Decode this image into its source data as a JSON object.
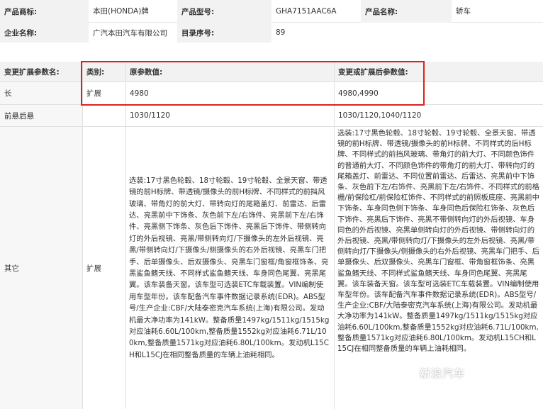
{
  "info": {
    "brand_label": "产品商标:",
    "brand_value": "本田(HONDA)牌",
    "model_label": "产品型号:",
    "model_value": "GHA7151AAC6A",
    "name_label": "产品名称:",
    "name_value": "轿车",
    "company_label": "企业名称:",
    "company_value": "广汽本田汽车有限公司",
    "catalog_label": "目录序号:",
    "catalog_value": "89"
  },
  "changes": {
    "headers": {
      "param": "变更扩展参数名:",
      "type": "类别:",
      "original": "原参数值:",
      "new": "变更或扩展后参数值:"
    },
    "rows": [
      {
        "param": "长",
        "type": "扩展",
        "original": "4980",
        "new": "4980,4990"
      },
      {
        "param": "前悬后悬",
        "type": "",
        "original": "1030/1120",
        "new": "1030/1120,1040/1120"
      },
      {
        "param": "其它",
        "type": "扩展",
        "original": "选装:17寸黑色轮毂、18寸轮毂、19寸轮毂、全景天窗、带透镜的前H标牌、带透镜/摄像头的前H标牌、不同样式的前挡风玻璃、带角灯的前大灯、带转向灯的尾箱盖灯、前雷达、后雷达、亮黑前中下饰条、灰色前下左/右饰件、亮黑前下左/右饰件、亮黑侧下饰条、灰色后下饰件、亮黑后下饰件、带侧转向灯的外后视镜、亮黑/带侧转向灯/下摄像头的左外后视镜、亮黑/带侧转向灯/下摄像头/侧摄像头的右外后视镜、亮黑车门把手、后单摄像头、后双摄像头、亮黑车门窗框/角窗框饰条、亮黑鲨鱼鳍天线、不同样式鲨鱼鳍天线、车身同色尾翼、亮黑尾翼。该车装备天窗。该车型可选装ETC车载装置。VIN编制使用车型年份。该车配备汽车事件数据记录系统(EDR)。ABS型号/生产企业:CBF/大陆泰密克汽车系统(上海)有限公司。发动机最大净功率为141kW。整备质量1497kg/1511kg/1515kg对应油耗6.60L/100km,整备质量1552kg对应油耗6.71L/100km,整备质量1571kg对应油耗6.80L/100km。发动机L15CH和L15CJ在相同整备质量的车辆上油耗相同。",
        "new": "选装:17寸黑色轮毂、18寸轮毂、19寸轮毂、全景天窗、带透镜的前H标牌、带透镜/摄像头的前H标牌、不同样式的后H标牌、不同样式的前挡风玻璃、带角灯的前大灯、不同颜色饰件的普通前大灯、不同颜色饰件的带角灯的前大灯、带转向灯的尾箱盖灯、前雷达、不同位置前雷达、后雷达、亮黑前中下饰条、灰色前下左/右饰件、亮黑前下左/右饰件、不同样式的前格栅/前保险杠/前保险杠饰件、不同样式的前照板底座、亮黑前中下饰条、车身同色侧下饰条、车身同色后保险杠饰条、灰色后下饰件、亮黑后下饰件、亮黑不带侧转向灯的外后视镜、车身同色的外后视镜、亮黑单侧转向灯的外后视镜、带侧转向灯的外后视镜、亮黑/带侧转向灯/下摄像头的左外后视镜、亮黑/带侧转向灯/下摄像头/侧摄像头的右外后视镜、亮黑车门把手、后单摄像头、后双摄像头、亮黑车门窗框、带角窗框饰条、亮黑鲨鱼鳍天线、不同样式鲨鱼鳍天线、车身同色尾翼、亮黑尾翼。该车装备天窗。该车型可选装ETC车载装置。VIN编制使用车型年份。该车配备汽车事件数据记录系统(EDR)。ABS型号/生产企业:CBF/大陆泰密克汽车系统(上海)有限公司。发动机最大净功率为141kW。整备质量1497kg/1511kg/1515kg对应油耗6.60L/100km,整备质量1552kg对应油耗6.71L/100km,整备质量1571kg对应油耗6.80L/100km。发动机L15CH和L15CJ在相同整备质量的车辆上油耗相同。"
      }
    ]
  },
  "watermark": "新浪汽车",
  "colors": {
    "highlight": "#e02020",
    "label_bg": "#f2f2f2"
  }
}
